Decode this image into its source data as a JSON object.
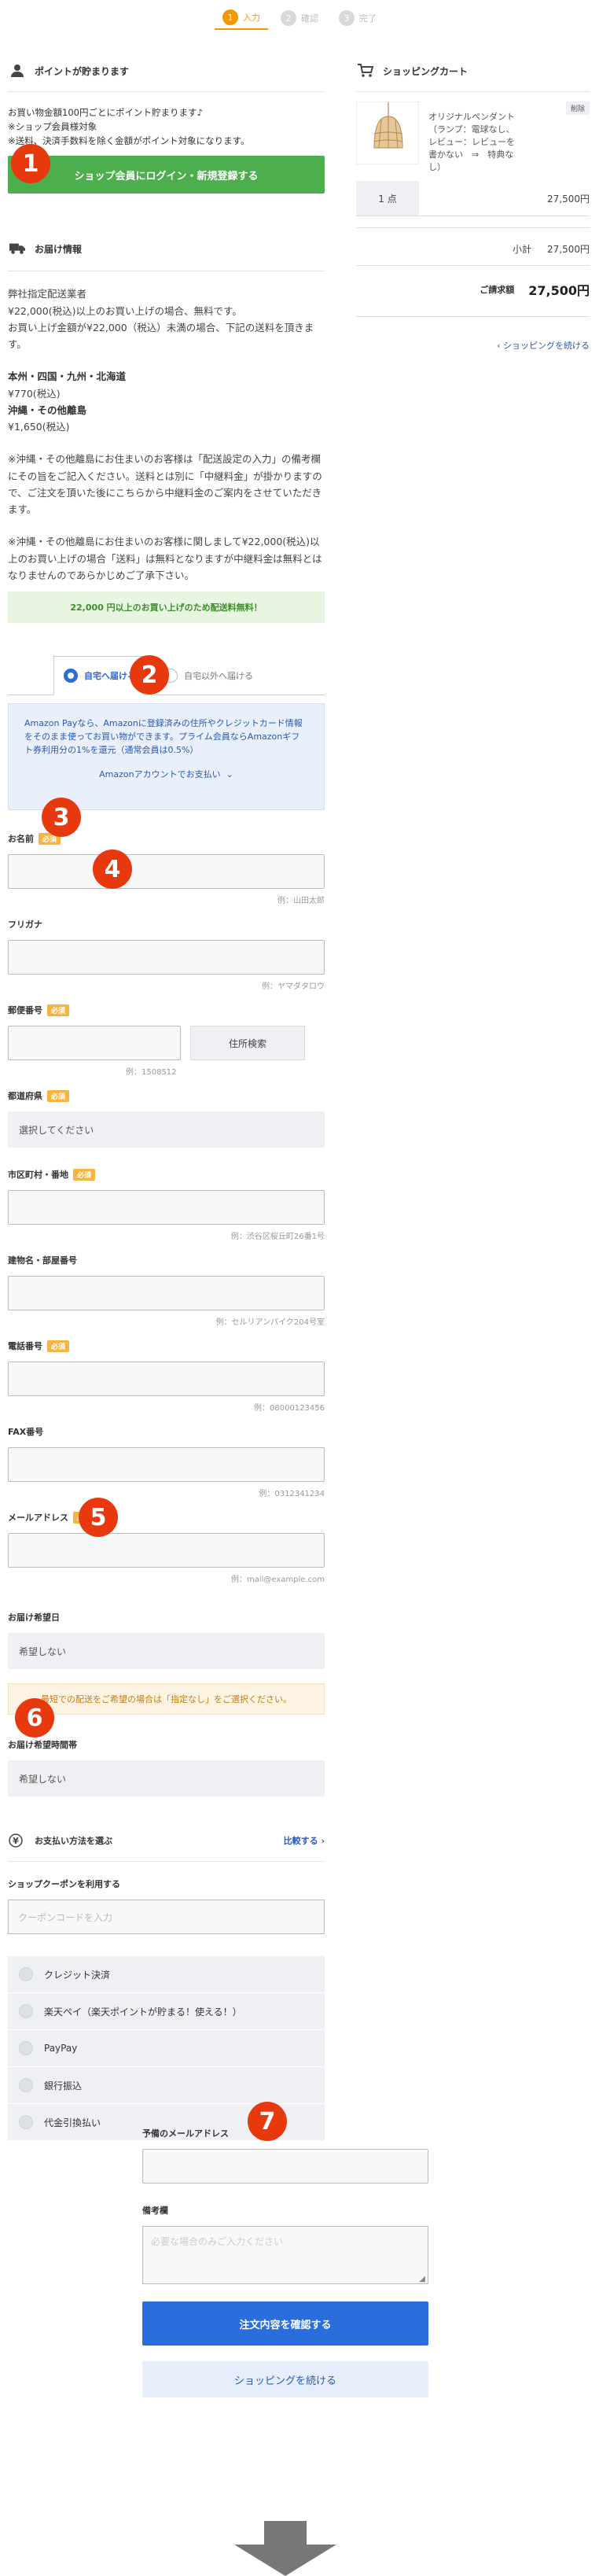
{
  "steps": [
    {
      "num": "1",
      "label": "入力"
    },
    {
      "num": "2",
      "label": "確認"
    },
    {
      "num": "3",
      "label": "完了"
    }
  ],
  "badges": [
    "1",
    "2",
    "3",
    "4",
    "5",
    "6",
    "7"
  ],
  "points": {
    "title": "ポイントが貯まります",
    "line1": "お買い物金額100円ごとにポイント貯まります♪",
    "line2": "※ショップ会員様対象",
    "line3": "※送料、決済手数料を除く金額がポイント対象になります。",
    "login_button": "ショップ会員にログイン・新規登録する"
  },
  "shipping_info": {
    "title": "お届け情報",
    "method": "弊社指定配送業者",
    "text1": "¥22,000(税込)以上のお買い上げの場合、無料です。",
    "text2": "お買い上げ金額が¥22,000（税込）未満の場合、下記の送料を頂きます。",
    "region1": "本州・四国・九州・北海道",
    "fee1": "¥770(税込)",
    "region2": "沖縄・その他離島",
    "fee2": "¥1,650(税込)",
    "note1": "※沖縄・その他離島にお住まいのお客様は「配送設定の入力」の備考欄にその旨をご記入ください。送料とは別に「中継料金」が掛かりますので、ご注文を頂いた後にこちらから中継料金のご案内をさせていただきます。",
    "note2": "※沖縄・その他離島にお住まいのお客様に関しまして¥22,000(税込)以上のお買い上げの場合「送料」は無料となりますが中継料金は無料とはなりませんのであらかじめご了承下さい。",
    "free_notice": "22,000 円以上のお買い上げのため配送料無料！"
  },
  "tabs": {
    "home": "自宅へ届ける",
    "other": "自宅以外へ届ける"
  },
  "amazon": {
    "text": "Amazon Payなら、Amazonに登録済みの住所やクレジットカード情報をそのまま使ってお買い物ができます。プライム会員ならAmazonギフト券利用分の1%を還元（通常会員は0.5%）",
    "link": "Amazonアカウントでお支払い"
  },
  "form": {
    "required": "必須",
    "name_label": "お名前",
    "name_example": "例：山田太郎",
    "kana_label": "フリガナ",
    "kana_example": "例：ヤマダタロウ",
    "zip_label": "郵便番号",
    "zip_button": "住所検索",
    "zip_example": "例：1508512",
    "pref_label": "都道府県",
    "pref_value": "選択してください",
    "city_label": "市区町村・番地",
    "city_example": "例：渋谷区桜丘町26番1号",
    "building_label": "建物名・部屋番号",
    "building_example": "例：セルリアンパイク204号室",
    "tel_label": "電話番号",
    "tel_example": "例：08000123456",
    "fax_label": "FAX番号",
    "fax_example": "例：0312341234",
    "email_label": "メールアドレス",
    "email_example": "例：mail@example.com",
    "date_label": "お届け希望日",
    "date_value": "希望しない",
    "date_notice": "最短での配送をご希望の場合は「指定なし」をご選択ください。",
    "time_label": "お届け希望時間帯",
    "time_value": "希望しない"
  },
  "payment": {
    "title": "お支払い方法を選ぶ",
    "compare": "比較する",
    "coupon_label": "ショップクーポンを利用する",
    "coupon_placeholder": "クーポンコードを入力",
    "methods": [
      "クレジット決済",
      "楽天ペイ（楽天ポイントが貯まる！使える！）",
      "PayPay",
      "銀行振込",
      "代金引換払い"
    ]
  },
  "bottom": {
    "backup_email_label": "予備のメールアドレス",
    "remarks_label": "備考欄",
    "remarks_placeholder": "必要な場合のみご入力ください",
    "confirm_button": "注文内容を確認する",
    "continue_button": "ショッピングを続ける"
  },
  "cart": {
    "title": "ショッピングカート",
    "product_name": "オリジナルペンダント（ランプ：電球なし、レビュー：レビューを書かない　⇒　特典なし）",
    "delete": "削除",
    "qty": "1 点",
    "price": "27,500円",
    "subtotal_label": "小計",
    "subtotal": "27,500円",
    "total_label": "ご請求額",
    "total": "27,500円",
    "continue": "ショッピングを続ける"
  }
}
